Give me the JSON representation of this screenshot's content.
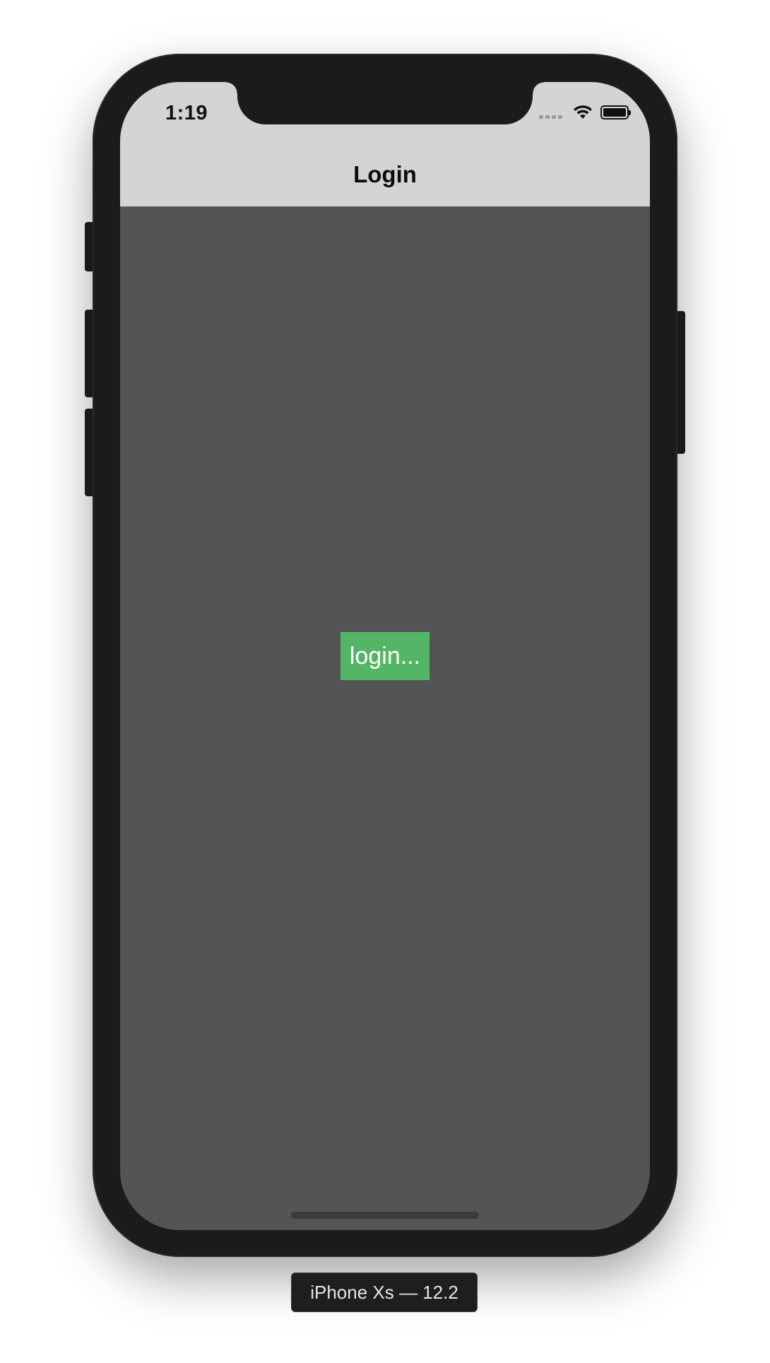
{
  "status_bar": {
    "time": "1:19",
    "icons": [
      "cellular-signal-icon",
      "wifi-icon",
      "battery-icon"
    ]
  },
  "nav_bar": {
    "title": "Login"
  },
  "main": {
    "login_button_label": "login...",
    "login_button_color": "#55b566",
    "background_color": "#545454"
  },
  "simulator": {
    "device_label": "iPhone Xs — 12.2"
  }
}
